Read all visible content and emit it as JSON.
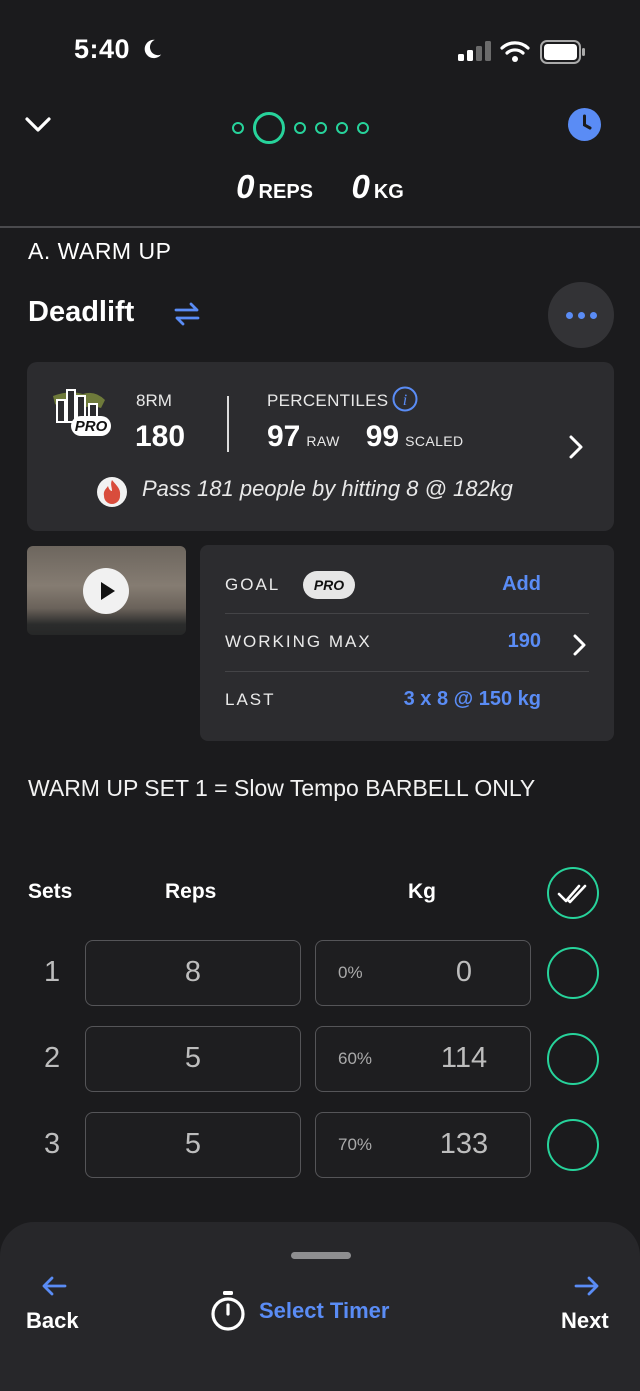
{
  "status_bar": {
    "time": "5:40"
  },
  "header": {
    "total_reps": "0",
    "reps_unit": "REPS",
    "total_weight": "0",
    "weight_unit": "KG"
  },
  "section": {
    "label": "A. WARM UP"
  },
  "exercise": {
    "name": "Deadlift"
  },
  "stats": {
    "logo_badge": "PRO",
    "rm_label": "8RM",
    "rm_value": "180",
    "percentiles_label": "PERCENTILES",
    "raw_value": "97",
    "raw_label": "RAW",
    "scaled_value": "99",
    "scaled_label": "SCALED",
    "pass_message": "Pass 181 people by hitting 8 @ 182kg"
  },
  "details": {
    "goal_label": "GOAL",
    "goal_badge": "PRO",
    "goal_action": "Add",
    "working_max_label": "WORKING MAX",
    "working_max_value": "190",
    "last_label": "LAST",
    "last_value": "3 x 8 @ 150 kg"
  },
  "notes": "WARM UP SET 1 = Slow Tempo BARBELL ONLY",
  "table": {
    "headers": {
      "sets": "Sets",
      "reps": "Reps",
      "kg": "Kg"
    },
    "rows": [
      {
        "set": "1",
        "reps": "8",
        "pct": "0%",
        "kg": "0"
      },
      {
        "set": "2",
        "reps": "5",
        "pct": "60%",
        "kg": "114"
      },
      {
        "set": "3",
        "reps": "5",
        "pct": "70%",
        "kg": "133"
      }
    ]
  },
  "footer": {
    "back_label": "Back",
    "timer_label": "Select Timer",
    "next_label": "Next"
  },
  "colors": {
    "accent_green": "#27d39b",
    "accent_blue": "#5a8cf5",
    "background": "#1b1b1d",
    "card": "#2c2c2f"
  },
  "icons": [
    "moon-icon",
    "signal-icon",
    "wifi-icon",
    "battery-icon",
    "chevron-down-icon",
    "clock-icon",
    "swap-icon",
    "more-icon",
    "info-icon",
    "chevron-right-icon",
    "fire-icon",
    "play-icon",
    "check-all-icon",
    "timer-icon",
    "arrow-left-icon",
    "arrow-right-icon"
  ]
}
